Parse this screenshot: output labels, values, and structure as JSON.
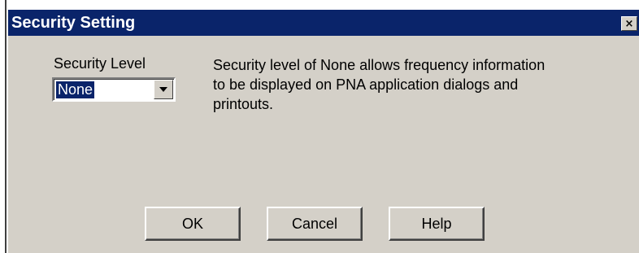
{
  "window": {
    "title": "Security Setting",
    "close_glyph": "×",
    "icons": {
      "close": "close-icon",
      "dropdown": "chevron-down-icon"
    }
  },
  "security_level": {
    "label": "Security Level",
    "selected": "None"
  },
  "description": {
    "lines": [
      "Security level of None allows frequency information",
      "to be displayed on PNA application dialogs and",
      "printouts."
    ]
  },
  "buttons": {
    "ok": "OK",
    "cancel": "Cancel",
    "help": "Help"
  },
  "colors": {
    "titlebar": "#0a246a",
    "dialog_face": "#d4d0c8",
    "selection": "#0a246a"
  }
}
